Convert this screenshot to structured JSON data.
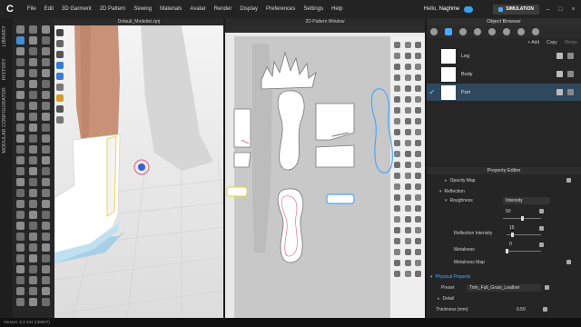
{
  "app": {
    "logo": "C",
    "menu": [
      "File",
      "Edit",
      "3D Garment",
      "2D Pattern",
      "Sewing",
      "Materials",
      "Avatar",
      "Render",
      "Display",
      "Preferences",
      "Settings",
      "Help"
    ],
    "greeting_prefix": "Hello, ",
    "user_name": "Naghme",
    "simulation_label": "SIMULATION",
    "window_controls": [
      "–",
      "□",
      "×"
    ]
  },
  "rail": {
    "tabs": [
      "LIBRARY",
      "HISTORY",
      "MODULAR CONFIGURATOR"
    ]
  },
  "window3d": {
    "title": "Default_Modelist.zprj"
  },
  "window2d": {
    "title": "2D Pattern Window"
  },
  "object_browser": {
    "title": "Object Browser",
    "add_label": "+ Add",
    "copy_label": "Copy",
    "merge_label": "Merge",
    "items": [
      {
        "name": "Leg",
        "selected": false
      },
      {
        "name": "Body",
        "selected": false
      },
      {
        "name": "Part",
        "selected": true
      }
    ]
  },
  "property_editor": {
    "title": "Property Editor",
    "opacity_map": "Opacity Map",
    "reflection": "Reflection",
    "roughness": "Roughness",
    "roughness_type": "Intensity",
    "roughness_value": "50",
    "roughness_level": 0.5,
    "reflection_intensity_label": "Reflection Intensity",
    "reflection_intensity_value": "15",
    "reflection_intensity_level": 0.15,
    "metalness_label": "Metalness",
    "metalness_value": "0",
    "metalness_level": 0.0,
    "metalness_map": "Metalness Map",
    "physical_property": "Physical Property",
    "preset_label": "Preset",
    "preset_value": "Trim_Full_Grain_Leather",
    "detail": "Detail",
    "thickness_label": "Thickness (mm)",
    "thickness_value": "0.50"
  },
  "status": {
    "version": "Version: 6.2.234 (r38007)"
  },
  "colors": {
    "accent": "#4aa8ff",
    "selection_outline": "#e05a8a",
    "yellow_outline": "#e8d84a",
    "blue_outline": "#4aa8ff"
  }
}
